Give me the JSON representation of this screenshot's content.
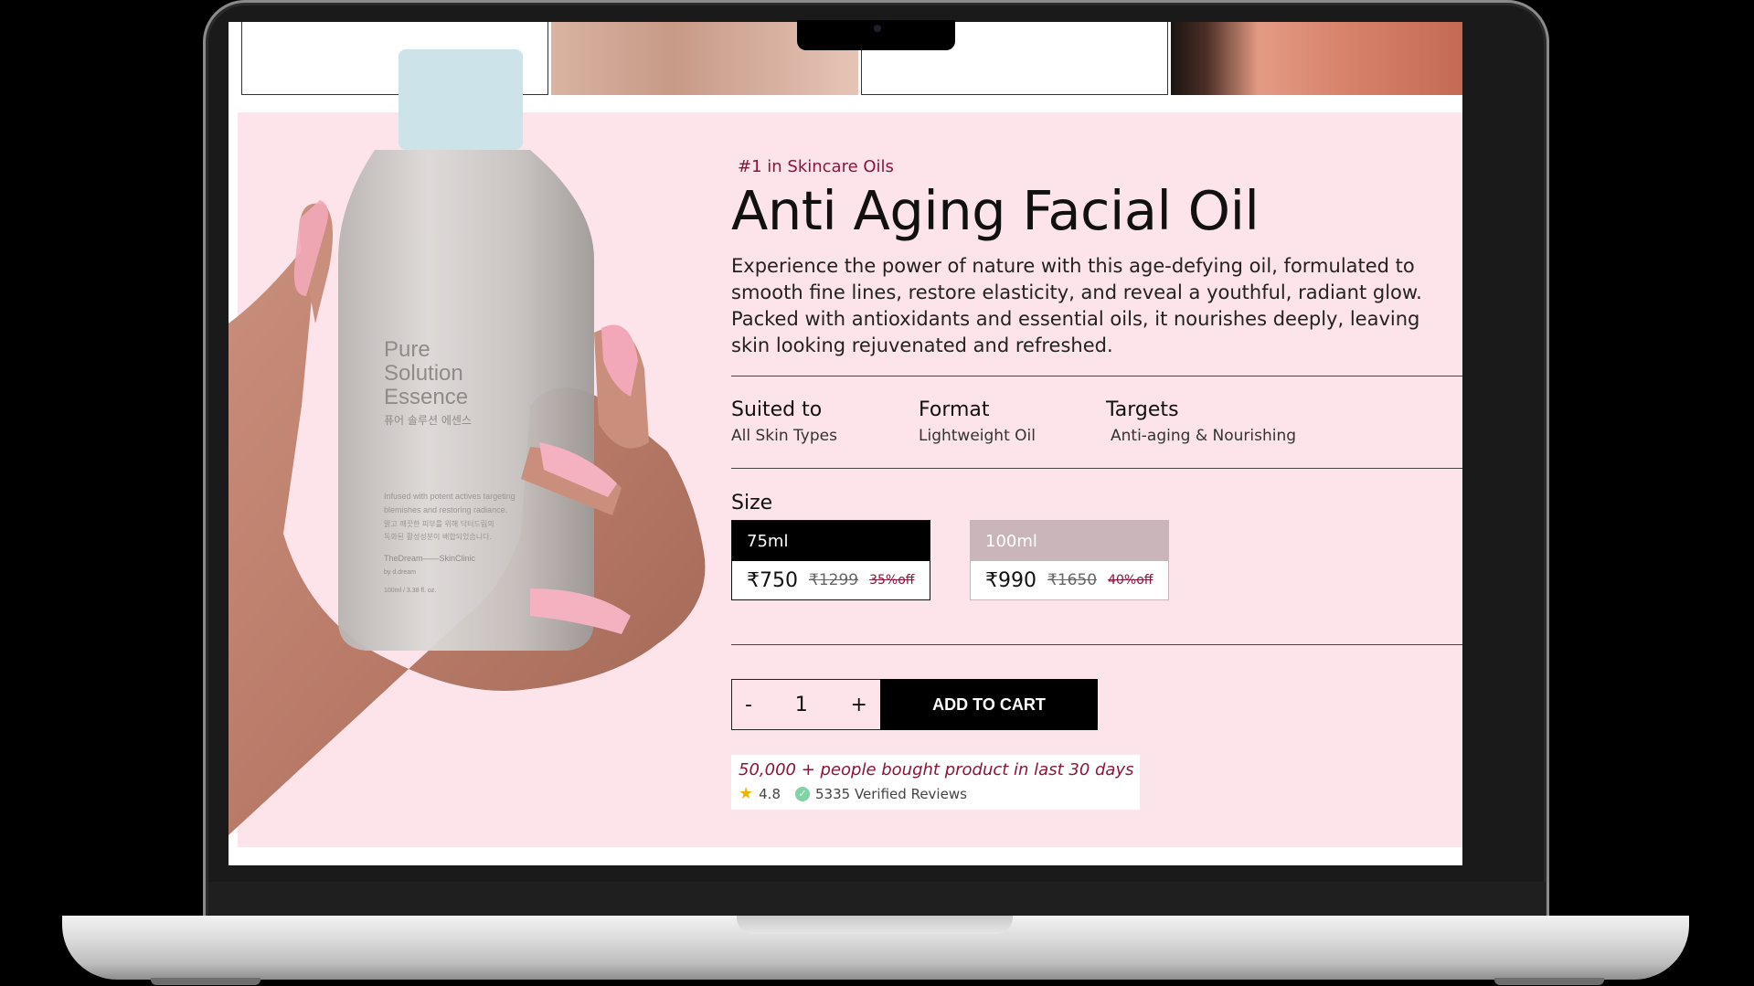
{
  "product": {
    "rank_badge": "#1 in Skincare Oils",
    "title": "Anti Aging Facial Oil",
    "description": "Experience the power of nature with this age-defying oil, formulated to smooth fine lines, restore elasticity, and reveal a youthful, radiant glow. Packed with antioxidants and essential oils, it nourishes deeply, leaving skin looking rejuvenated and refreshed.",
    "image_label": {
      "line1": "Pure",
      "line2": "Solution",
      "line3": "Essence",
      "korean": "퓨어 솔루션 에센스",
      "fine_print1": "Infused with potent actives targeting",
      "fine_print2": "blemishes and restoring radiance.",
      "fine_print3": "맑고 깨끗한 피부를 위해 닥터드림의",
      "fine_print4": "독화된 활성성분이 배합되었습니다.",
      "brand": "TheDream——SkinClinic",
      "brand_by": "by d.dream",
      "volume": "100ml / 3.38 fl. oz."
    }
  },
  "specs": [
    {
      "label": "Suited to",
      "value": "All Skin Types"
    },
    {
      "label": "Format",
      "value": "Lightweight Oil"
    },
    {
      "label": "Targets",
      "value": "Anti-aging & Nourishing"
    }
  ],
  "size": {
    "label": "Size",
    "options": [
      {
        "name": "75ml",
        "price": "₹750",
        "mrp": "₹1299",
        "discount": "35%off",
        "selected": true
      },
      {
        "name": "100ml",
        "price": "₹990",
        "mrp": "₹1650",
        "discount": "40%off",
        "selected": false
      }
    ]
  },
  "cart": {
    "minus": "-",
    "quantity": "1",
    "plus": "+",
    "button": "ADD TO CART"
  },
  "social_proof": {
    "text": "50,000 + people bought product in last 30 days",
    "rating": "4.8",
    "reviews": "5335 Verified Reviews"
  },
  "colors": {
    "page_bg": "#fde4ea",
    "accent": "#8a1538",
    "button_bg": "#000000",
    "unselected_chip": "#c9b5ba"
  }
}
